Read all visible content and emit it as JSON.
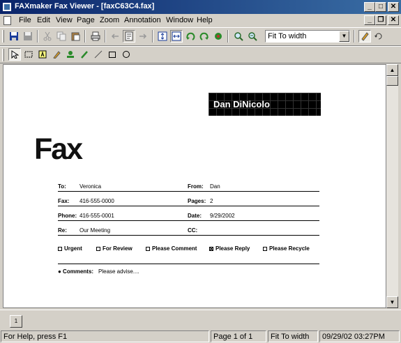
{
  "window": {
    "title": "FAXmaker Fax Viewer - [faxC63C4.fax]",
    "controls": {
      "minimize": "_",
      "maximize": "□",
      "close": "✕"
    }
  },
  "menu": {
    "items": [
      {
        "label": "File"
      },
      {
        "label": "Edit"
      },
      {
        "label": "View"
      },
      {
        "label": "Page"
      },
      {
        "label": "Zoom"
      },
      {
        "label": "Annotation"
      },
      {
        "label": "Window"
      },
      {
        "label": "Help"
      }
    ],
    "doc_controls": {
      "minimize": "_",
      "restore": "❐",
      "close": "✕"
    }
  },
  "toolbar": {
    "zoom_select": {
      "value": "Fit To width"
    }
  },
  "fax": {
    "sender_banner": "Dan DiNicolo",
    "heading": "Fax",
    "fields": {
      "to_label": "To:",
      "to_value": "Veronica",
      "from_label": "From:",
      "from_value": "Dan",
      "fax_label": "Fax:",
      "fax_value": "416-555-0000",
      "pages_label": "Pages:",
      "pages_value": "2",
      "phone_label": "Phone:",
      "phone_value": "416-555-0001",
      "date_label": "Date:",
      "date_value": "9/29/2002",
      "re_label": "Re:",
      "re_value": "Our Meeting",
      "cc_label": "CC:",
      "cc_value": ""
    },
    "checkboxes": [
      {
        "label": "Urgent",
        "checked": false
      },
      {
        "label": "For Review",
        "checked": false
      },
      {
        "label": "Please Comment",
        "checked": false
      },
      {
        "label": "Please Reply",
        "checked": true
      },
      {
        "label": "Please Recycle",
        "checked": false
      }
    ],
    "comments_label": "● Comments:",
    "comments_value": "Please advise...."
  },
  "page_tab": {
    "label": "1"
  },
  "status": {
    "help": "For Help, press F1",
    "page": "Page 1 of 1",
    "zoom": "Fit To width",
    "datetime": "09/29/02 03:27PM"
  },
  "colors": {
    "title_gradient_start": "#0a246a",
    "title_gradient_end": "#3a6ea5",
    "chrome": "#d4d0c8"
  }
}
